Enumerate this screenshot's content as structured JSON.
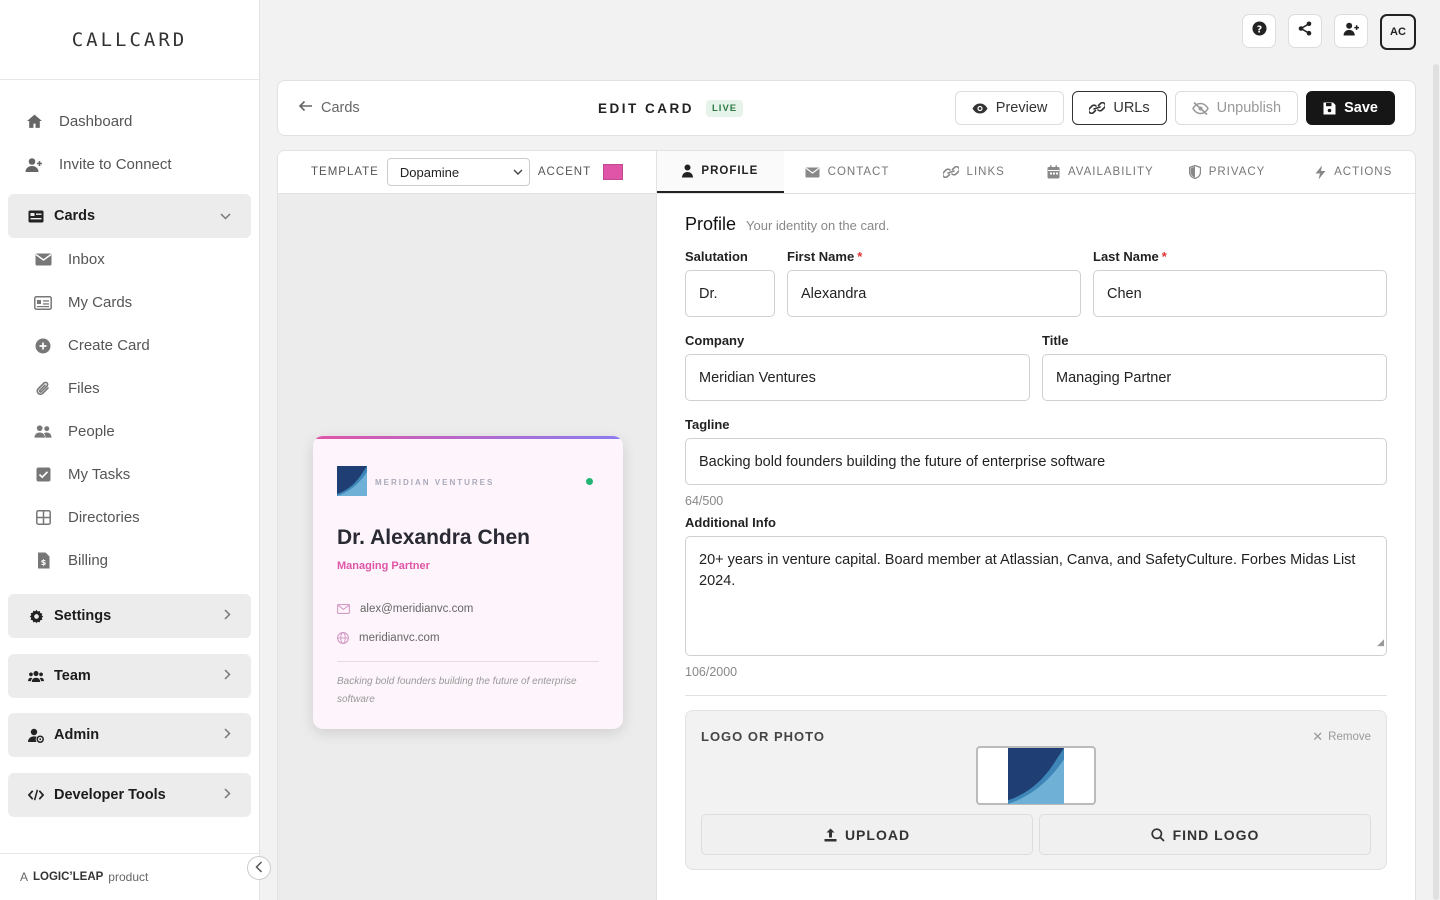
{
  "brand": {
    "logo": "CALLCARD",
    "footer_prefix": "A",
    "footer_brand": "LOGIC’LEAP",
    "footer_suffix": "product"
  },
  "sidebar": {
    "top_items": [
      {
        "label": "Dashboard",
        "icon": "home-icon"
      },
      {
        "label": "Invite to Connect",
        "icon": "user-plus-icon"
      }
    ],
    "cards_group": {
      "label": "Cards",
      "icon": "card-icon"
    },
    "cards_items": [
      {
        "label": "Inbox",
        "icon": "mail-icon"
      },
      {
        "label": "My Cards",
        "icon": "id-card-icon"
      },
      {
        "label": "Create Card",
        "icon": "plus-circle-icon"
      },
      {
        "label": "Files",
        "icon": "paperclip-icon"
      },
      {
        "label": "People",
        "icon": "people-icon"
      },
      {
        "label": "My Tasks",
        "icon": "checkbox-icon"
      },
      {
        "label": "Directories",
        "icon": "grid-icon"
      },
      {
        "label": "Billing",
        "icon": "invoice-icon"
      }
    ],
    "groups": [
      {
        "label": "Settings",
        "icon": "gear-icon"
      },
      {
        "label": "Team",
        "icon": "team-icon"
      },
      {
        "label": "Admin",
        "icon": "user-cog-icon"
      },
      {
        "label": "Developer Tools",
        "icon": "code-icon"
      }
    ]
  },
  "topbar": {
    "avatar_initials": "AC"
  },
  "header": {
    "back_label": "Cards",
    "title": "EDIT CARD",
    "badge": "LIVE",
    "preview": "Preview",
    "urls": "URLs",
    "unpublish": "Unpublish",
    "save": "Save"
  },
  "template_bar": {
    "template_label": "TEMPLATE",
    "template_value": "Dopamine",
    "accent_label": "ACCENT",
    "accent_color": "#e055a8"
  },
  "preview_card": {
    "company": "MERIDIAN VENTURES",
    "name": "Dr. Alexandra Chen",
    "title": "Managing Partner",
    "email": "alex@meridianvc.com",
    "website": "meridianvc.com",
    "tagline": "Backing bold founders building the future of enterprise software"
  },
  "tabs": [
    {
      "label": "PROFILE",
      "icon": "person-icon"
    },
    {
      "label": "CONTACT",
      "icon": "envelope-icon"
    },
    {
      "label": "LINKS",
      "icon": "link-icon"
    },
    {
      "label": "AVAILABILITY",
      "icon": "calendar-icon"
    },
    {
      "label": "PRIVACY",
      "icon": "shield-icon"
    },
    {
      "label": "ACTIONS",
      "icon": "bolt-icon"
    }
  ],
  "profile": {
    "title": "Profile",
    "subtitle": "Your identity on the card.",
    "salutation": {
      "label": "Salutation",
      "value": "Dr."
    },
    "first_name": {
      "label": "First Name",
      "value": "Alexandra"
    },
    "last_name": {
      "label": "Last Name",
      "value": "Chen"
    },
    "company": {
      "label": "Company",
      "value": "Meridian Ventures"
    },
    "title_field": {
      "label": "Title",
      "value": "Managing Partner"
    },
    "tagline": {
      "label": "Tagline",
      "value": "Backing bold founders building the future of enterprise software",
      "count": "64/500"
    },
    "additional": {
      "label": "Additional Info",
      "value": "20+ years in venture capital. Board member at Atlassian, Canva, and SafetyCulture. Forbes Midas List 2024.",
      "count": "106/2000"
    },
    "logo": {
      "title": "LOGO OR PHOTO",
      "remove": "Remove",
      "upload": "UPLOAD",
      "find": "FIND LOGO"
    }
  }
}
